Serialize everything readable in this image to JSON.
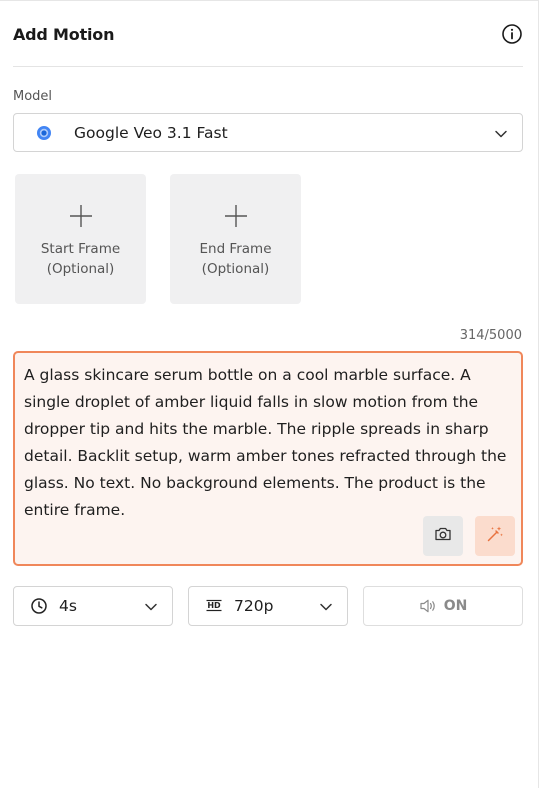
{
  "header": {
    "title": "Add Motion"
  },
  "model": {
    "label": "Model",
    "selected": "Google Veo 3.1 Fast",
    "logo_color": "#4285f4"
  },
  "frames": [
    {
      "label": "Start Frame",
      "sublabel": "(Optional)"
    },
    {
      "label": "End Frame",
      "sublabel": "(Optional)"
    }
  ],
  "prompt": {
    "counter": "314/5000",
    "text": "A glass skincare serum bottle on a cool marble surface. A single droplet of amber liquid falls in slow motion from the dropper tip and hits the marble. The ripple spreads in sharp detail. Backlit setup, warm amber tones refracted through the glass. No text. No background elements. The product is the entire frame.",
    "accent_color": "#f0875a"
  },
  "controls": {
    "duration": {
      "value": "4s",
      "icon": "clock-icon"
    },
    "resolution": {
      "value": "720p",
      "icon": "hd-icon"
    },
    "audio": {
      "label": "ON",
      "icon": "speaker-icon"
    }
  }
}
